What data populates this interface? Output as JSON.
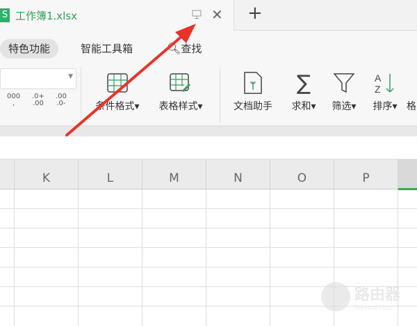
{
  "titlebar": {
    "logo": "S",
    "tab_title": "工作簿1.xlsx",
    "new_tab": "+"
  },
  "menu": {
    "items": [
      "特色功能",
      "智能工具箱",
      "查找"
    ]
  },
  "ribbon": {
    "number_formats": [
      "000\n,",
      ".0+\n.00",
      ".00\n.0-"
    ],
    "buttons": [
      "条件格式",
      "表格样式",
      "文档助手",
      "求和",
      "筛选",
      "排序",
      "格"
    ]
  },
  "sheet": {
    "columns": [
      "K",
      "L",
      "M",
      "N",
      "O",
      "P",
      ""
    ]
  },
  "watermark": {
    "text": "路由器",
    "sub": "luyouqi.com"
  },
  "colors": {
    "accent": "#2e9e5c",
    "arrow": "#e8332a"
  }
}
